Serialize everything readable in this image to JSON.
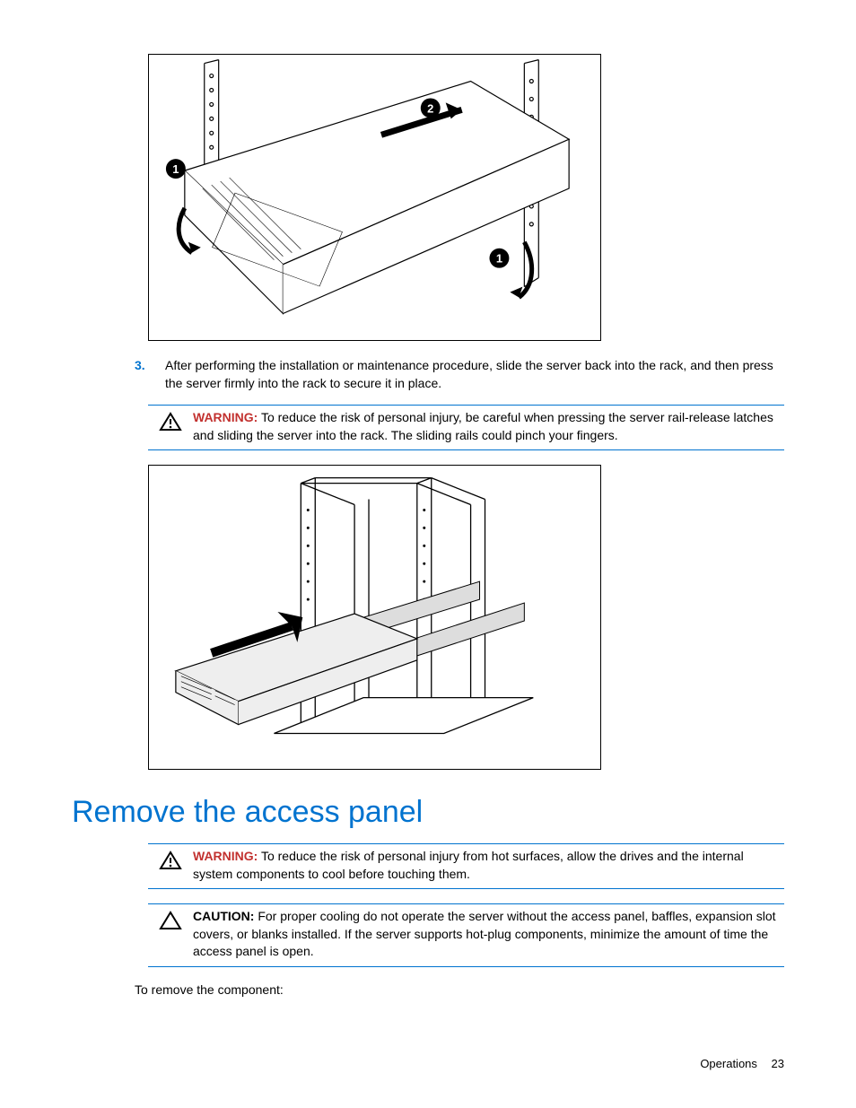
{
  "step3": {
    "number": "3.",
    "text": "After performing the installation or maintenance procedure, slide the server back into the rack, and then press the server firmly into the rack to secure it in place."
  },
  "warning1": {
    "label": "WARNING:",
    "text": "To reduce the risk of personal injury, be careful when pressing the server rail-release latches and sliding the server into the rack. The sliding rails could pinch your fingers."
  },
  "heading": "Remove the access panel",
  "warning2": {
    "label": "WARNING:",
    "text": "To reduce the risk of personal injury from hot surfaces, allow the drives and the internal system components to cool before touching them."
  },
  "caution1": {
    "label": "CAUTION:",
    "text": "For proper cooling do not operate the server without the access panel, baffles, expansion slot covers, or blanks installed. If the server supports hot-plug components, minimize the amount of time the access panel is open."
  },
  "removeIntro": "To remove the component:",
  "footer": {
    "section": "Operations",
    "page": "23"
  }
}
